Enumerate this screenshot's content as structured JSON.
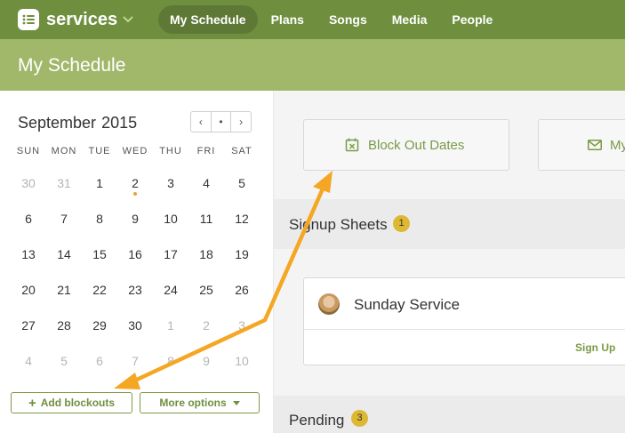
{
  "nav": {
    "brand": "services",
    "items": [
      "My Schedule",
      "Plans",
      "Songs",
      "Media",
      "People"
    ],
    "active_index": 0
  },
  "page": {
    "title": "My Schedule"
  },
  "calendar": {
    "month": "September",
    "year": "2015",
    "weekdays": [
      "SUN",
      "MON",
      "TUE",
      "WED",
      "THU",
      "FRI",
      "SAT"
    ],
    "weeks": [
      [
        {
          "d": "30",
          "m": true
        },
        {
          "d": "31",
          "m": true
        },
        {
          "d": "1"
        },
        {
          "d": "2",
          "dot": true
        },
        {
          "d": "3"
        },
        {
          "d": "4"
        },
        {
          "d": "5"
        }
      ],
      [
        {
          "d": "6"
        },
        {
          "d": "7"
        },
        {
          "d": "8"
        },
        {
          "d": "9"
        },
        {
          "d": "10"
        },
        {
          "d": "11"
        },
        {
          "d": "12"
        }
      ],
      [
        {
          "d": "13"
        },
        {
          "d": "14"
        },
        {
          "d": "15"
        },
        {
          "d": "16"
        },
        {
          "d": "17"
        },
        {
          "d": "18"
        },
        {
          "d": "19"
        }
      ],
      [
        {
          "d": "20"
        },
        {
          "d": "21"
        },
        {
          "d": "22"
        },
        {
          "d": "23"
        },
        {
          "d": "24"
        },
        {
          "d": "25"
        },
        {
          "d": "26"
        }
      ],
      [
        {
          "d": "27"
        },
        {
          "d": "28"
        },
        {
          "d": "29"
        },
        {
          "d": "30"
        },
        {
          "d": "1",
          "m": true
        },
        {
          "d": "2",
          "m": true
        },
        {
          "d": "3",
          "m": true
        }
      ],
      [
        {
          "d": "4",
          "m": true
        },
        {
          "d": "5",
          "m": true
        },
        {
          "d": "6",
          "m": true
        },
        {
          "d": "7",
          "m": true
        },
        {
          "d": "8",
          "m": true
        },
        {
          "d": "9",
          "m": true
        },
        {
          "d": "10",
          "m": true
        }
      ]
    ],
    "prev_glyph": "‹",
    "today_glyph": "•",
    "next_glyph": "›"
  },
  "sidebar_buttons": {
    "add_blockouts": "Add blockouts",
    "more_options": "More options"
  },
  "main": {
    "block_out_label": "Block Out Dates",
    "second_card_label": "My",
    "signup_section": {
      "label": "Signup Sheets",
      "count": "1"
    },
    "signup_item": {
      "name": "Sunday Service",
      "action": "Sign Up"
    },
    "pending_section": {
      "label": "Pending",
      "count": "3"
    }
  },
  "colors": {
    "nav_bg": "#6f8f3f",
    "title_bg": "#a1b86a",
    "accent_green": "#7b9a47",
    "badge_yellow": "#dcb833",
    "arrow_orange": "#f5a623"
  }
}
